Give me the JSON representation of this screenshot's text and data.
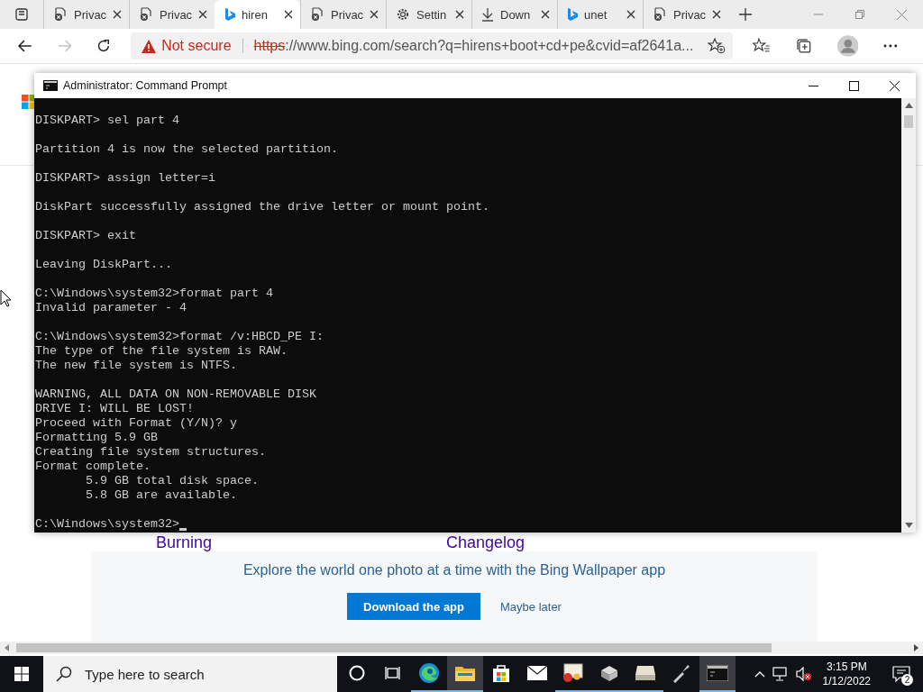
{
  "browser": {
    "tabs": [
      {
        "label": "Privac",
        "kind": "private",
        "selected": false
      },
      {
        "label": "Privac",
        "kind": "private",
        "selected": false
      },
      {
        "label": "hiren",
        "kind": "bing",
        "selected": true
      },
      {
        "label": "Privac",
        "kind": "private",
        "selected": false
      },
      {
        "label": "Settin",
        "kind": "settings",
        "selected": false
      },
      {
        "label": "Down",
        "kind": "download",
        "selected": false
      },
      {
        "label": "unet",
        "kind": "bing",
        "selected": false
      },
      {
        "label": "Privac",
        "kind": "private",
        "selected": false
      }
    ],
    "address_bar": {
      "warning": "Not secure",
      "scheme": "https",
      "url": "://www.bing.com/search?q=hirens+boot+cd+pe&cvid=af2641a..."
    }
  },
  "page": {
    "links": [
      "Burning",
      "Changelog"
    ],
    "banner": {
      "text": "Explore the world one photo at a time with the Bing Wallpaper app",
      "button": "Download the app",
      "link": "Maybe later"
    }
  },
  "console_window": {
    "title": "Administrator: Command Prompt",
    "blocks": [
      [
        "DISKPART> sel part 4"
      ],
      [
        "Partition 4 is now the selected partition."
      ],
      [
        "DISKPART> assign letter=i"
      ],
      [
        "DiskPart successfully assigned the drive letter or mount point."
      ],
      [
        "DISKPART> exit"
      ],
      [
        "Leaving DiskPart..."
      ],
      [
        "C:\\Windows\\system32>format part 4",
        "Invalid parameter - 4"
      ],
      [
        "C:\\Windows\\system32>format /v:HBCD_PE I:",
        "The type of the file system is RAW.",
        "The new file system is NTFS."
      ],
      [
        "WARNING, ALL DATA ON NON-REMOVABLE DISK",
        "DRIVE I: WILL BE LOST!",
        "Proceed with Format (Y/N)? y",
        "Formatting 5.9 GB",
        "Creating file system structures.",
        "Format complete.",
        "       5.9 GB total disk space.",
        "       5.8 GB are available."
      ],
      [
        "C:\\Windows\\system32>"
      ]
    ]
  },
  "taskbar": {
    "search_placeholder": "Type here to search",
    "apps": [
      {
        "kind": "cortana",
        "running": false,
        "selected": false
      },
      {
        "kind": "taskview",
        "running": false,
        "selected": false
      },
      {
        "kind": "edge",
        "running": true,
        "selected": false
      },
      {
        "kind": "folder",
        "running": true,
        "selected": true
      },
      {
        "kind": "store",
        "running": false,
        "selected": false
      },
      {
        "kind": "mail",
        "running": false,
        "selected": false
      },
      {
        "kind": "certificate",
        "running": true,
        "selected": false
      },
      {
        "kind": "drive",
        "running": true,
        "selected": false
      },
      {
        "kind": "scanner",
        "running": true,
        "selected": false
      },
      {
        "kind": "tool",
        "running": false,
        "selected": false
      },
      {
        "kind": "console",
        "running": true,
        "selected": true
      }
    ],
    "time": "3:15 PM",
    "date": "1/12/2022",
    "notifications": "2"
  }
}
